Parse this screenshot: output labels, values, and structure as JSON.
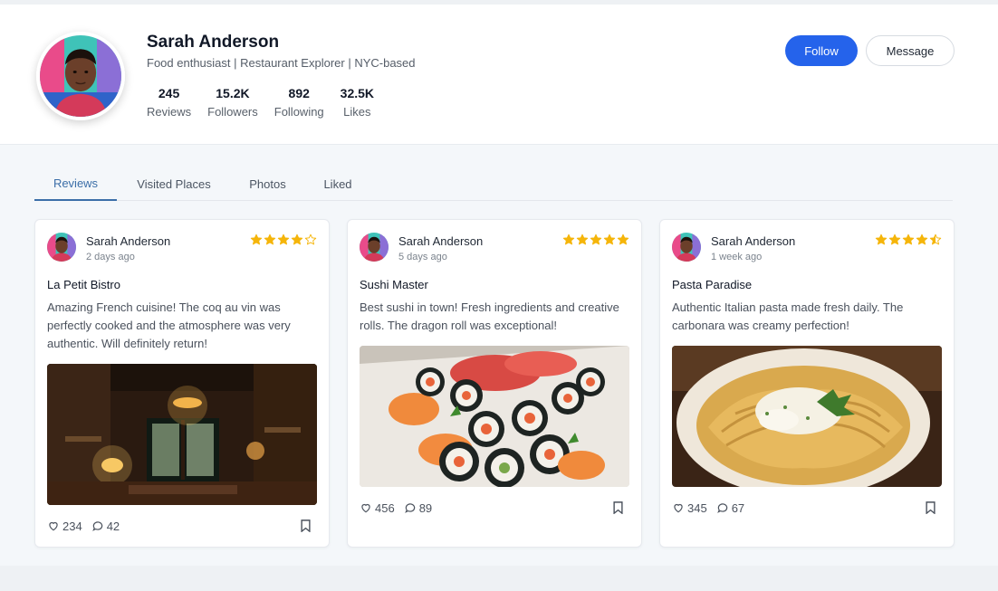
{
  "profile": {
    "name": "Sarah Anderson",
    "bio": "Food enthusiast | Restaurant Explorer | NYC-based",
    "stats": [
      {
        "value": "245",
        "label": "Reviews"
      },
      {
        "value": "15.2K",
        "label": "Followers"
      },
      {
        "value": "892",
        "label": "Following"
      },
      {
        "value": "32.5K",
        "label": "Likes"
      }
    ],
    "follow_label": "Follow",
    "message_label": "Message"
  },
  "tabs": [
    {
      "label": "Reviews",
      "active": true
    },
    {
      "label": "Visited Places",
      "active": false
    },
    {
      "label": "Photos",
      "active": false
    },
    {
      "label": "Liked",
      "active": false
    }
  ],
  "reviews": [
    {
      "author": "Sarah Anderson",
      "time": "2 days ago",
      "rating": 4,
      "place": "La Petit Bistro",
      "text": "Amazing French cuisine! The coq au vin was perfectly cooked and the atmosphere was very authentic. Will definitely return!",
      "photo": "restaurant-interior",
      "likes": "234",
      "comments": "42"
    },
    {
      "author": "Sarah Anderson",
      "time": "5 days ago",
      "rating": 5,
      "place": "Sushi Master",
      "text": "Best sushi in town! Fresh ingredients and creative rolls. The dragon roll was exceptional!",
      "photo": "sushi-platter",
      "likes": "456",
      "comments": "89"
    },
    {
      "author": "Sarah Anderson",
      "time": "1 week ago",
      "rating": 4.5,
      "place": "Pasta Paradise",
      "text": "Authentic Italian pasta made fresh daily. The carbonara was creamy perfection!",
      "photo": "pasta-carbonara",
      "likes": "345",
      "comments": "67"
    }
  ],
  "colors": {
    "accent": "#2563eb",
    "tab_active": "#3b6ea8",
    "star": "#f5b50a"
  },
  "icons": {
    "like": "heart-icon",
    "comment": "comment-icon",
    "save": "bookmark-icon",
    "rating": "star-icon"
  }
}
